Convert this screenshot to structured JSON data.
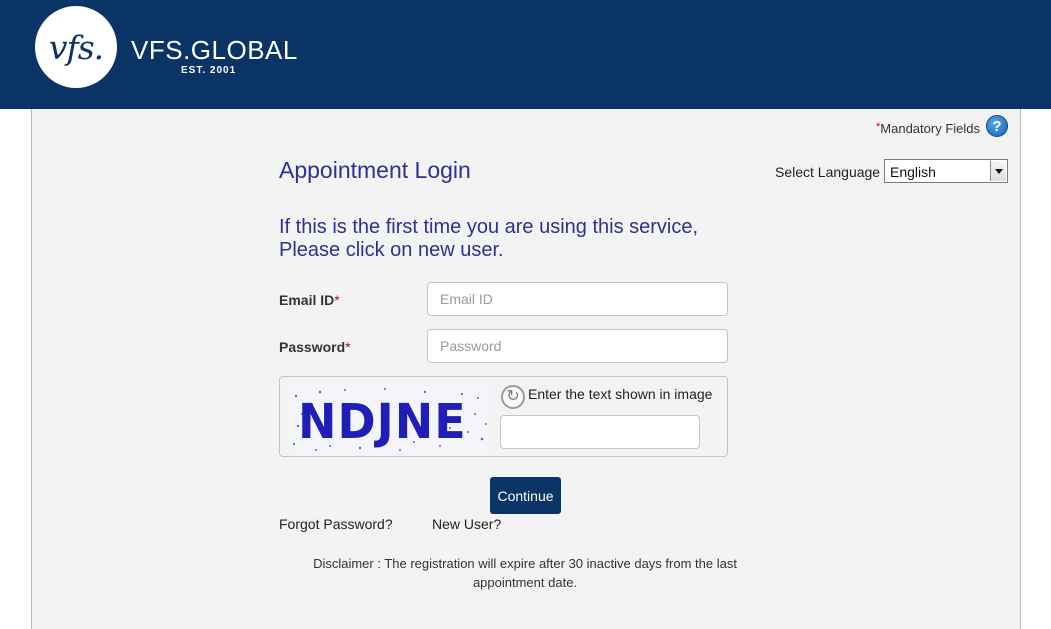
{
  "header": {
    "logo_mark": "vfs.",
    "brand": "VFS.GLOBAL",
    "established": "EST. 2001",
    "bg_color": "#0a3466"
  },
  "mandatory": {
    "star": "*",
    "label": "Mandatory Fields",
    "help_icon": "question-help-icon"
  },
  "page": {
    "title": "Appointment Login",
    "info_line1": "If this is the first time you are using this service,",
    "info_line2": "Please click on new user."
  },
  "language": {
    "label": "Select Language :",
    "selected": "English"
  },
  "form": {
    "email_label": "Email ID",
    "email_placeholder": "Email ID",
    "email_value": "",
    "password_label": "Password",
    "password_placeholder": "Password",
    "password_value": "",
    "required_mark": "*"
  },
  "captcha": {
    "image_text": "NDJNE",
    "refresh_icon": "refresh-icon",
    "label": "Enter the text shown in image",
    "value": ""
  },
  "actions": {
    "continue_label": "Continue",
    "forgot_label": "Forgot Password?",
    "new_user_label": "New User?"
  },
  "disclaimer": {
    "line1": "Disclaimer : The registration will expire after 30 inactive days from the last",
    "line2": "appointment date."
  },
  "colors": {
    "accent": "#2e3192",
    "required": "#d0021b",
    "button": "#0a3466"
  }
}
